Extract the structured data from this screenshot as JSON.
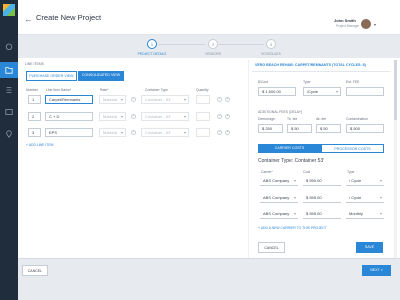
{
  "header": {
    "back_label": "←",
    "title": "Create New Project",
    "user_name": "John Smith",
    "user_role": "Project Manager",
    "notif_count": "2"
  },
  "steps": [
    {
      "num": "1",
      "label": "PROJECT DETAILS",
      "active": true
    },
    {
      "num": "2",
      "label": "VENDORS",
      "active": false
    },
    {
      "num": "3",
      "label": "SCHEDULES",
      "active": false
    }
  ],
  "line_items": {
    "section_label": "LINE ITEMS",
    "view_buttons": {
      "purchase_order": "PURCHASE ORDER VIEW",
      "consolidated": "CONSOLIDATED VIEW"
    },
    "columns": {
      "number": "Number",
      "line_item_name": "Line Item Name*",
      "rate": "Rate*",
      "container_type": "Container Type",
      "quantity": "Quantity"
    },
    "rows": [
      {
        "number": "1",
        "name": "Carpet/Remnants",
        "rate": "Material",
        "container": "Container - 53'"
      },
      {
        "number": "2",
        "name": "C + D",
        "rate": "Material",
        "container": "Container - 53'"
      },
      {
        "number": "3",
        "name": "EPS",
        "rate": "Material",
        "container": "Container - 53'"
      }
    ],
    "add_link": "+ ADD LINE ITEM"
  },
  "panel": {
    "title": "VERO BEACH REHAB: CARPET/REMNANTS (TOTAL CYCLES: 8)",
    "price_label": "$/Cost",
    "price_value": "$ 1,500.00",
    "type_label": "Type",
    "type_value": "/Cycle",
    "est_label": "Est. FEE",
    "est_value": "",
    "fees_label": "ADDITIONAL FEES (DELAY)",
    "fee_cols": [
      "Demurrage",
      "Tk. fee",
      "dk. fee",
      "Contamination"
    ],
    "fee_values": [
      "$ 250",
      "$ 50",
      "$ 50",
      "$ 500"
    ],
    "tabs": {
      "carrier": "CARRIER COSTS",
      "processor": "PROCESSOR COSTS"
    },
    "container_type": "Container Type: Container 53'",
    "carrier_cols": [
      "Carrier*",
      "Cost",
      "Type"
    ],
    "carriers": [
      {
        "name": "ABS Company",
        "cost": "$ 555.00",
        "type": "/ Cycle"
      },
      {
        "name": "ABS Company",
        "cost": "$ 555.00",
        "type": "/ Cycle"
      },
      {
        "name": "ABS Company",
        "cost": "$ 555.00",
        "type": "Monthly"
      }
    ],
    "add_carrier": "+ ADD A NEW CARRIER TO THIS PROJECT",
    "cancel": "CANCEL",
    "save": "SAVE"
  },
  "footer": {
    "cancel": "CANCEL",
    "next": "NEXT >"
  },
  "colors": {
    "accent": "#2a86d6",
    "sidebar": "#1f2d3d"
  }
}
